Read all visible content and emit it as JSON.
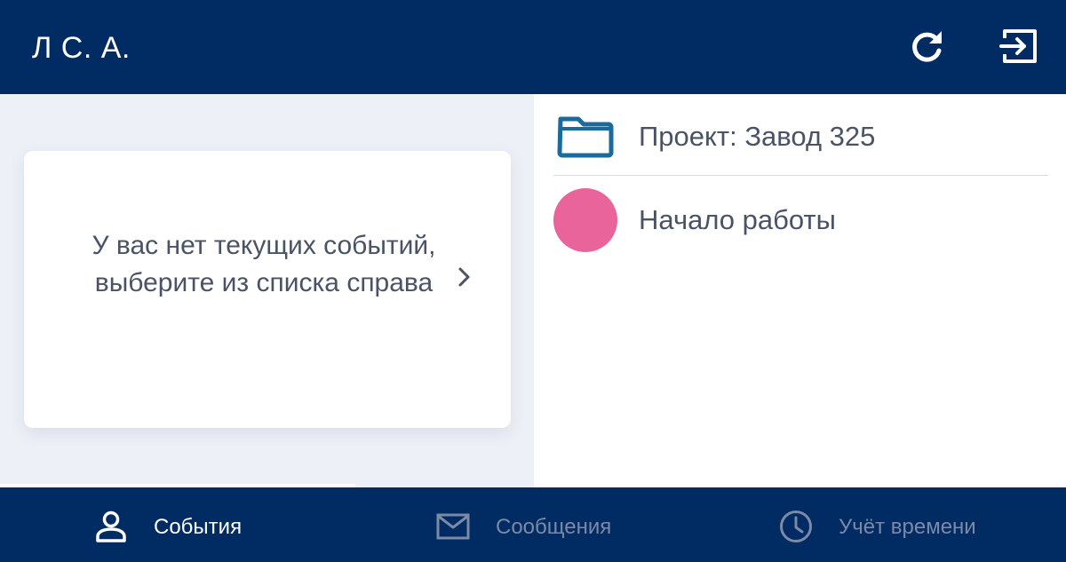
{
  "header": {
    "user_initials": "Л С. А.",
    "refresh_icon": "refresh-icon",
    "logout_icon": "logout-icon"
  },
  "left_panel": {
    "empty_message": "У вас нет текущих событий, выберите из списка справа",
    "chevron_icon": "chevron-right-icon"
  },
  "right_panel": {
    "project": {
      "label": "Проект: Завод 325",
      "icon": "folder-icon"
    },
    "status": {
      "label": "Начало работы",
      "color": "#e8649a"
    }
  },
  "bottom_nav": {
    "active_index": 0,
    "items": [
      {
        "label": "События",
        "icon": "person-icon"
      },
      {
        "label": "Сообщения",
        "icon": "mail-icon"
      },
      {
        "label": "Учёт времени",
        "icon": "clock-icon"
      }
    ]
  },
  "colors": {
    "brand": "#002b63",
    "accent_folder": "#1a6a9a",
    "text": "#4a5365",
    "inactive_nav": "#7b8aa6"
  }
}
